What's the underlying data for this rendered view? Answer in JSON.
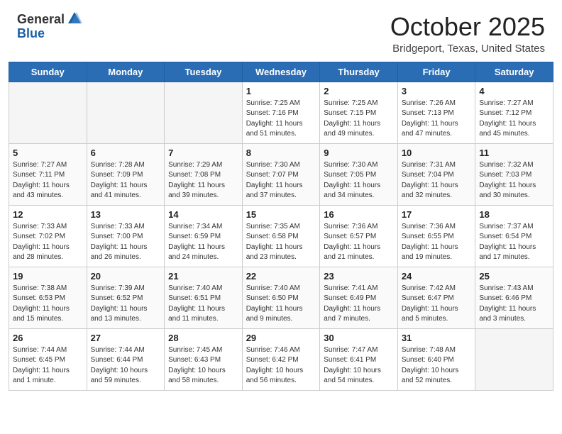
{
  "header": {
    "logo_general": "General",
    "logo_blue": "Blue",
    "title": "October 2025",
    "subtitle": "Bridgeport, Texas, United States"
  },
  "weekdays": [
    "Sunday",
    "Monday",
    "Tuesday",
    "Wednesday",
    "Thursday",
    "Friday",
    "Saturday"
  ],
  "weeks": [
    [
      {
        "day": "",
        "empty": true
      },
      {
        "day": "",
        "empty": true
      },
      {
        "day": "",
        "empty": true
      },
      {
        "day": "1",
        "sunrise": "7:25 AM",
        "sunset": "7:16 PM",
        "daylight": "11 hours and 51 minutes."
      },
      {
        "day": "2",
        "sunrise": "7:25 AM",
        "sunset": "7:15 PM",
        "daylight": "11 hours and 49 minutes."
      },
      {
        "day": "3",
        "sunrise": "7:26 AM",
        "sunset": "7:13 PM",
        "daylight": "11 hours and 47 minutes."
      },
      {
        "day": "4",
        "sunrise": "7:27 AM",
        "sunset": "7:12 PM",
        "daylight": "11 hours and 45 minutes."
      }
    ],
    [
      {
        "day": "5",
        "sunrise": "7:27 AM",
        "sunset": "7:11 PM",
        "daylight": "11 hours and 43 minutes."
      },
      {
        "day": "6",
        "sunrise": "7:28 AM",
        "sunset": "7:09 PM",
        "daylight": "11 hours and 41 minutes."
      },
      {
        "day": "7",
        "sunrise": "7:29 AM",
        "sunset": "7:08 PM",
        "daylight": "11 hours and 39 minutes."
      },
      {
        "day": "8",
        "sunrise": "7:30 AM",
        "sunset": "7:07 PM",
        "daylight": "11 hours and 37 minutes."
      },
      {
        "day": "9",
        "sunrise": "7:30 AM",
        "sunset": "7:05 PM",
        "daylight": "11 hours and 34 minutes."
      },
      {
        "day": "10",
        "sunrise": "7:31 AM",
        "sunset": "7:04 PM",
        "daylight": "11 hours and 32 minutes."
      },
      {
        "day": "11",
        "sunrise": "7:32 AM",
        "sunset": "7:03 PM",
        "daylight": "11 hours and 30 minutes."
      }
    ],
    [
      {
        "day": "12",
        "sunrise": "7:33 AM",
        "sunset": "7:02 PM",
        "daylight": "11 hours and 28 minutes."
      },
      {
        "day": "13",
        "sunrise": "7:33 AM",
        "sunset": "7:00 PM",
        "daylight": "11 hours and 26 minutes."
      },
      {
        "day": "14",
        "sunrise": "7:34 AM",
        "sunset": "6:59 PM",
        "daylight": "11 hours and 24 minutes."
      },
      {
        "day": "15",
        "sunrise": "7:35 AM",
        "sunset": "6:58 PM",
        "daylight": "11 hours and 23 minutes."
      },
      {
        "day": "16",
        "sunrise": "7:36 AM",
        "sunset": "6:57 PM",
        "daylight": "11 hours and 21 minutes."
      },
      {
        "day": "17",
        "sunrise": "7:36 AM",
        "sunset": "6:55 PM",
        "daylight": "11 hours and 19 minutes."
      },
      {
        "day": "18",
        "sunrise": "7:37 AM",
        "sunset": "6:54 PM",
        "daylight": "11 hours and 17 minutes."
      }
    ],
    [
      {
        "day": "19",
        "sunrise": "7:38 AM",
        "sunset": "6:53 PM",
        "daylight": "11 hours and 15 minutes."
      },
      {
        "day": "20",
        "sunrise": "7:39 AM",
        "sunset": "6:52 PM",
        "daylight": "11 hours and 13 minutes."
      },
      {
        "day": "21",
        "sunrise": "7:40 AM",
        "sunset": "6:51 PM",
        "daylight": "11 hours and 11 minutes."
      },
      {
        "day": "22",
        "sunrise": "7:40 AM",
        "sunset": "6:50 PM",
        "daylight": "11 hours and 9 minutes."
      },
      {
        "day": "23",
        "sunrise": "7:41 AM",
        "sunset": "6:49 PM",
        "daylight": "11 hours and 7 minutes."
      },
      {
        "day": "24",
        "sunrise": "7:42 AM",
        "sunset": "6:47 PM",
        "daylight": "11 hours and 5 minutes."
      },
      {
        "day": "25",
        "sunrise": "7:43 AM",
        "sunset": "6:46 PM",
        "daylight": "11 hours and 3 minutes."
      }
    ],
    [
      {
        "day": "26",
        "sunrise": "7:44 AM",
        "sunset": "6:45 PM",
        "daylight": "11 hours and 1 minute."
      },
      {
        "day": "27",
        "sunrise": "7:44 AM",
        "sunset": "6:44 PM",
        "daylight": "10 hours and 59 minutes."
      },
      {
        "day": "28",
        "sunrise": "7:45 AM",
        "sunset": "6:43 PM",
        "daylight": "10 hours and 58 minutes."
      },
      {
        "day": "29",
        "sunrise": "7:46 AM",
        "sunset": "6:42 PM",
        "daylight": "10 hours and 56 minutes."
      },
      {
        "day": "30",
        "sunrise": "7:47 AM",
        "sunset": "6:41 PM",
        "daylight": "10 hours and 54 minutes."
      },
      {
        "day": "31",
        "sunrise": "7:48 AM",
        "sunset": "6:40 PM",
        "daylight": "10 hours and 52 minutes."
      },
      {
        "day": "",
        "empty": true
      }
    ]
  ],
  "labels": {
    "sunrise": "Sunrise:",
    "sunset": "Sunset:",
    "daylight": "Daylight:"
  }
}
